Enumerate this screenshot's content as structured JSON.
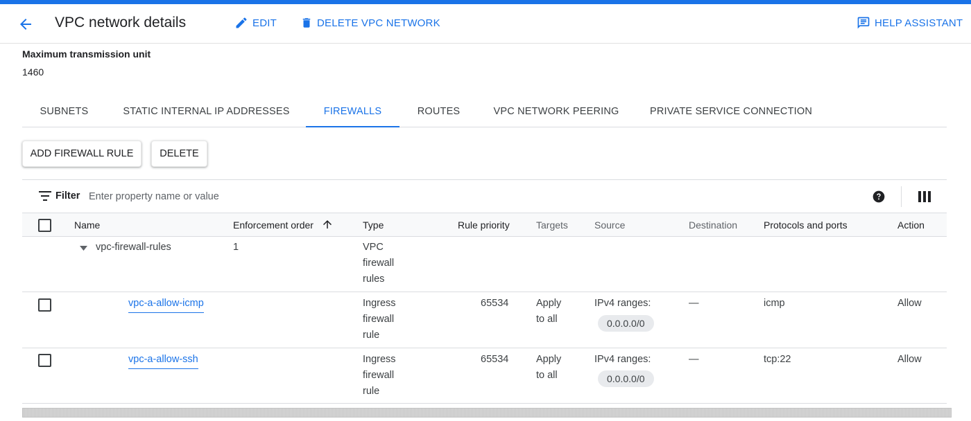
{
  "colors": {
    "accent": "#1a73e8",
    "text": "#202124",
    "muted": "#5f6368",
    "chip_bg": "#e8eaed"
  },
  "header": {
    "back_icon": "arrow-back-icon",
    "title": "VPC network details",
    "edit_label": "EDIT",
    "edit_icon": "pencil-icon",
    "delete_label": "DELETE VPC NETWORK",
    "delete_icon": "trash-icon",
    "help_label": "HELP ASSISTANT",
    "help_icon": "chat-help-icon"
  },
  "mtu": {
    "label": "Maximum transmission unit",
    "value": "1460"
  },
  "tabs": [
    {
      "label": "SUBNETS",
      "active": false
    },
    {
      "label": "STATIC INTERNAL IP ADDRESSES",
      "active": false
    },
    {
      "label": "FIREWALLS",
      "active": true
    },
    {
      "label": "ROUTES",
      "active": false
    },
    {
      "label": "VPC NETWORK PEERING",
      "active": false
    },
    {
      "label": "PRIVATE SERVICE CONNECTION",
      "active": false
    }
  ],
  "actions": {
    "add_rule": "ADD FIREWALL RULE",
    "delete": "DELETE"
  },
  "filter": {
    "label": "Filter",
    "placeholder": "Enter property name or value"
  },
  "table": {
    "columns": {
      "name": "Name",
      "enforcement": "Enforcement order",
      "enforcement_sort": "ascending",
      "type": "Type",
      "priority": "Rule priority",
      "targets": "Targets",
      "source": "Source",
      "destination": "Destination",
      "protocols": "Protocols and ports",
      "action": "Action"
    },
    "group": {
      "name": "vpc-firewall-rules",
      "enforcement": "1",
      "type": [
        "VPC",
        "firewall",
        "rules"
      ],
      "expanded": true
    },
    "rows": [
      {
        "name": "vpc-a-allow-icmp",
        "type": [
          "Ingress",
          "firewall",
          "rule"
        ],
        "priority": "65534",
        "targets": [
          "Apply",
          "to all"
        ],
        "source_label": "IPv4 ranges:",
        "source_range": "0.0.0.0/0",
        "destination": "—",
        "protocols": "icmp",
        "action": "Allow"
      },
      {
        "name": "vpc-a-allow-ssh",
        "type": [
          "Ingress",
          "firewall",
          "rule"
        ],
        "priority": "65534",
        "targets": [
          "Apply",
          "to all"
        ],
        "source_label": "IPv4 ranges:",
        "source_range": "0.0.0.0/0",
        "destination": "—",
        "protocols": "tcp:22",
        "action": "Allow"
      }
    ]
  }
}
